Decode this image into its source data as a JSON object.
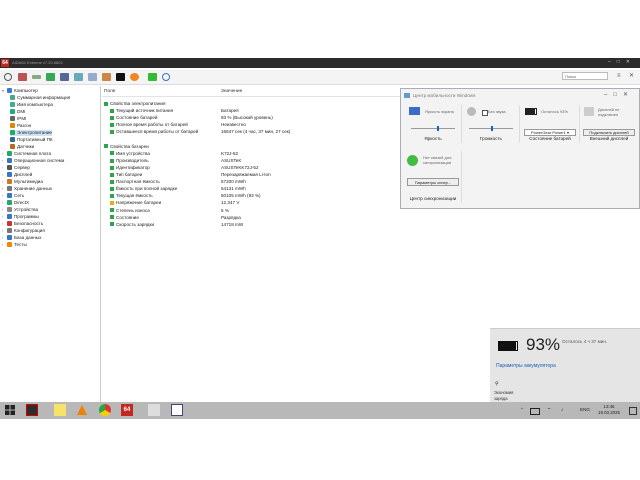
{
  "window": {
    "title": "AIDA64 Extreme v7.20.6802",
    "app_icon_label": "64",
    "controls": [
      "–",
      "□",
      "✕"
    ]
  },
  "toolbar": {
    "search_placeholder": "Поиск",
    "right_buttons": [
      "≡",
      "✕"
    ]
  },
  "tree": [
    {
      "label": "Компьютер",
      "indent": 0,
      "arrow": "▾",
      "color": "#3a7bd5"
    },
    {
      "label": "Суммарная информация",
      "indent": 1,
      "color": "#4a8"
    },
    {
      "label": "Имя компьютера",
      "indent": 1,
      "color": "#4a8"
    },
    {
      "label": "DMI",
      "indent": 1,
      "color": "#2a8"
    },
    {
      "label": "IPMI",
      "indent": 1,
      "color": "#666"
    },
    {
      "label": "Разгон",
      "indent": 1,
      "color": "#d80"
    },
    {
      "label": "Электропитание",
      "indent": 1,
      "color": "#2a6",
      "selected": true
    },
    {
      "label": "Портативный ПК",
      "indent": 1,
      "color": "#369"
    },
    {
      "label": "Датчики",
      "indent": 1,
      "color": "#b62"
    },
    {
      "label": "Системная плата",
      "indent": 0,
      "arrow": "›",
      "color": "#2a6"
    },
    {
      "label": "Операционная система",
      "indent": 0,
      "arrow": "›",
      "color": "#37c"
    },
    {
      "label": "Сервер",
      "indent": 0,
      "arrow": "›",
      "color": "#555"
    },
    {
      "label": "Дисплей",
      "indent": 0,
      "arrow": "›",
      "color": "#37c"
    },
    {
      "label": "Мультимедиа",
      "indent": 0,
      "arrow": "›",
      "color": "#c72"
    },
    {
      "label": "Хранение данных",
      "indent": 0,
      "arrow": "›",
      "color": "#777"
    },
    {
      "label": "Сеть",
      "indent": 0,
      "arrow": "›",
      "color": "#37c"
    },
    {
      "label": "DirectX",
      "indent": 0,
      "arrow": "›",
      "color": "#2a6"
    },
    {
      "label": "Устройства",
      "indent": 0,
      "arrow": "›",
      "color": "#888"
    },
    {
      "label": "Программы",
      "indent": 0,
      "arrow": "›",
      "color": "#37c"
    },
    {
      "label": "Безопасность",
      "indent": 0,
      "arrow": "›",
      "color": "#c33"
    },
    {
      "label": "Конфигурация",
      "indent": 0,
      "arrow": "›",
      "color": "#777"
    },
    {
      "label": "База данных",
      "indent": 0,
      "arrow": "›",
      "color": "#37c"
    },
    {
      "label": "Тесты",
      "indent": 0,
      "arrow": "›",
      "color": "#e80"
    }
  ],
  "columns": {
    "field": "Поле",
    "value": "Значение"
  },
  "rows": [
    {
      "field": "Свойства электропитания",
      "value": "",
      "group": true
    },
    {
      "field": "Текущий источник питания",
      "value": "Батарея",
      "icon": "g"
    },
    {
      "field": "Состояние батарей",
      "value": "93 % (Высокий уровень)",
      "icon": "g"
    },
    {
      "field": "Полное время работы от батарей",
      "value": "Неизвестно",
      "icon": "g"
    },
    {
      "field": "Оставшееся время работы от батарей",
      "value": "16647 сек (4 час, 37 мин, 27 сек)",
      "icon": "g"
    },
    {
      "field": "",
      "value": "",
      "spacer": true
    },
    {
      "field": "Свойства батареи",
      "value": "",
      "group": true
    },
    {
      "field": "Имя устройства",
      "value": "K72J-52",
      "icon": "g"
    },
    {
      "field": "Производитель",
      "value": "ASUSTeK",
      "icon": "g"
    },
    {
      "field": "Идентификатор",
      "value": "ASUSTeKK72J-52",
      "icon": "g"
    },
    {
      "field": "Тип батареи",
      "value": "Перезаряжаемая Li-Ion",
      "icon": "g"
    },
    {
      "field": "Паспортная ёмкость",
      "value": "57200 mWh",
      "icon": "g"
    },
    {
      "field": "Ёмкость при полной зарядке",
      "value": "54131 mWh",
      "icon": "g"
    },
    {
      "field": "Текущая ёмкость",
      "value": "50105 mWh  (93 %)",
      "icon": "g"
    },
    {
      "field": "Напряжение батареи",
      "value": "12.347 V",
      "icon": "y"
    },
    {
      "field": "Степень износа",
      "value": "5 %",
      "icon": "g"
    },
    {
      "field": "Состояние",
      "value": "Разрядка",
      "icon": "g"
    },
    {
      "field": "Скорость зарядки",
      "value": "14718 mW",
      "icon": "g"
    }
  ],
  "mobility_center": {
    "title": "Центр мобильности Windows",
    "controls": [
      "–",
      "□",
      "✕"
    ],
    "tiles": [
      {
        "sub": "Яркость экрана",
        "label": "Яркость"
      },
      {
        "sub": "Без звука",
        "label": "Громкость"
      },
      {
        "sub": "Осталось 93%",
        "button": "PowerGear Power1 ▾",
        "label": "Состояние батарей"
      },
      {
        "sub": "Дисплей не подключен",
        "button": "Подключить дисплей",
        "label": "Внешний дисплей"
      }
    ],
    "sync": {
      "sub": "Нет связей для синхронизации",
      "button": "Параметры синхр...",
      "label": "Центр синхронизации"
    }
  },
  "battery_flyout": {
    "percent": "93%",
    "remaining": "Осталось 4 ч 37 мин.",
    "settings_link": "Параметры аккумулятора",
    "mode_label": "Экономия заряда"
  },
  "taskbar": {
    "lang": "ENG",
    "time": "13:46",
    "date": "19.03.2025",
    "app_label": "64"
  },
  "colors": {
    "accent": "#0a64c8",
    "selection": "#cfe3f7",
    "titlebar": "#2b2b2b",
    "taskbar": "#b8b8b8"
  }
}
